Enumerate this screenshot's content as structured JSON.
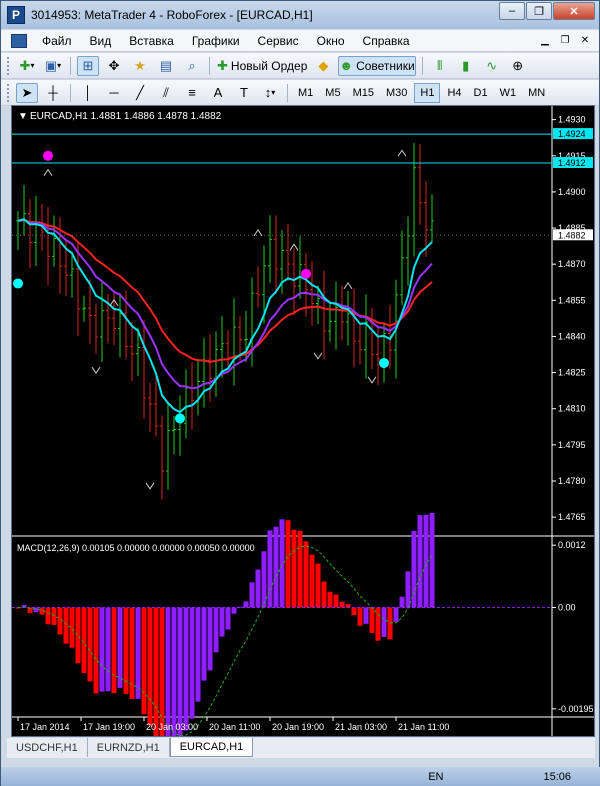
{
  "window": {
    "title": "3014953: MetaTrader 4 - RoboForex - [EURCAD,H1]",
    "minimize": "–",
    "restore": "❐",
    "close": "✕"
  },
  "menu": {
    "items": [
      "Файл",
      "Вид",
      "Вставка",
      "Графики",
      "Сервис",
      "Окно",
      "Справка"
    ]
  },
  "toolbar": {
    "new_order": "Новый Ордер",
    "experts": "Советники"
  },
  "timeframes": [
    "M1",
    "M5",
    "M15",
    "M30",
    "H1",
    "H4",
    "D1",
    "W1",
    "MN"
  ],
  "active_timeframe": "H1",
  "chart": {
    "header": "EURCAD,H1  1.4881 1.4886 1.4878 1.4882",
    "bid_label": "1.4882",
    "hline1_label": "1.4924",
    "hline2_label": "1.4912",
    "price_ticks": [
      "1.4930",
      "1.4915",
      "1.4900",
      "1.4885",
      "1.4870",
      "1.4855",
      "1.4840",
      "1.4825",
      "1.4810",
      "1.4795",
      "1.4780",
      "1.4765"
    ],
    "time_ticks": [
      "17 Jan 2014",
      "17 Jan 19:00",
      "20 Jan 03:00",
      "20 Jan 11:00",
      "20 Jan 19:00",
      "21 Jan 03:00",
      "21 Jan 11:00"
    ],
    "colors": {
      "bull": "#22cc22",
      "bear": "#dd2222",
      "ma_fast": "#00e5ee",
      "ma_mid": "#9933ff",
      "ma_slow": "#ff2222",
      "hline": "#00e5ee",
      "dot_buy": "#00ffff",
      "dot_sell": "#ff00ff"
    }
  },
  "macd": {
    "header": "MACD(12,26,9) 0.00105 0.00000 0.00000 0.00050 0.00000",
    "ticks": [
      "0.0012",
      "0.00",
      "-0.00195"
    ],
    "colors": {
      "neg": "#ff0000",
      "pos": "#8f1fff",
      "signal": "#22aa22"
    }
  },
  "tabs": [
    "USDCHF,H1",
    "EURNZD,H1",
    "EURCAD,H1"
  ],
  "active_tab": "EURCAD,H1",
  "taskbar": {
    "lang": "EN",
    "clock": "15:06"
  }
}
